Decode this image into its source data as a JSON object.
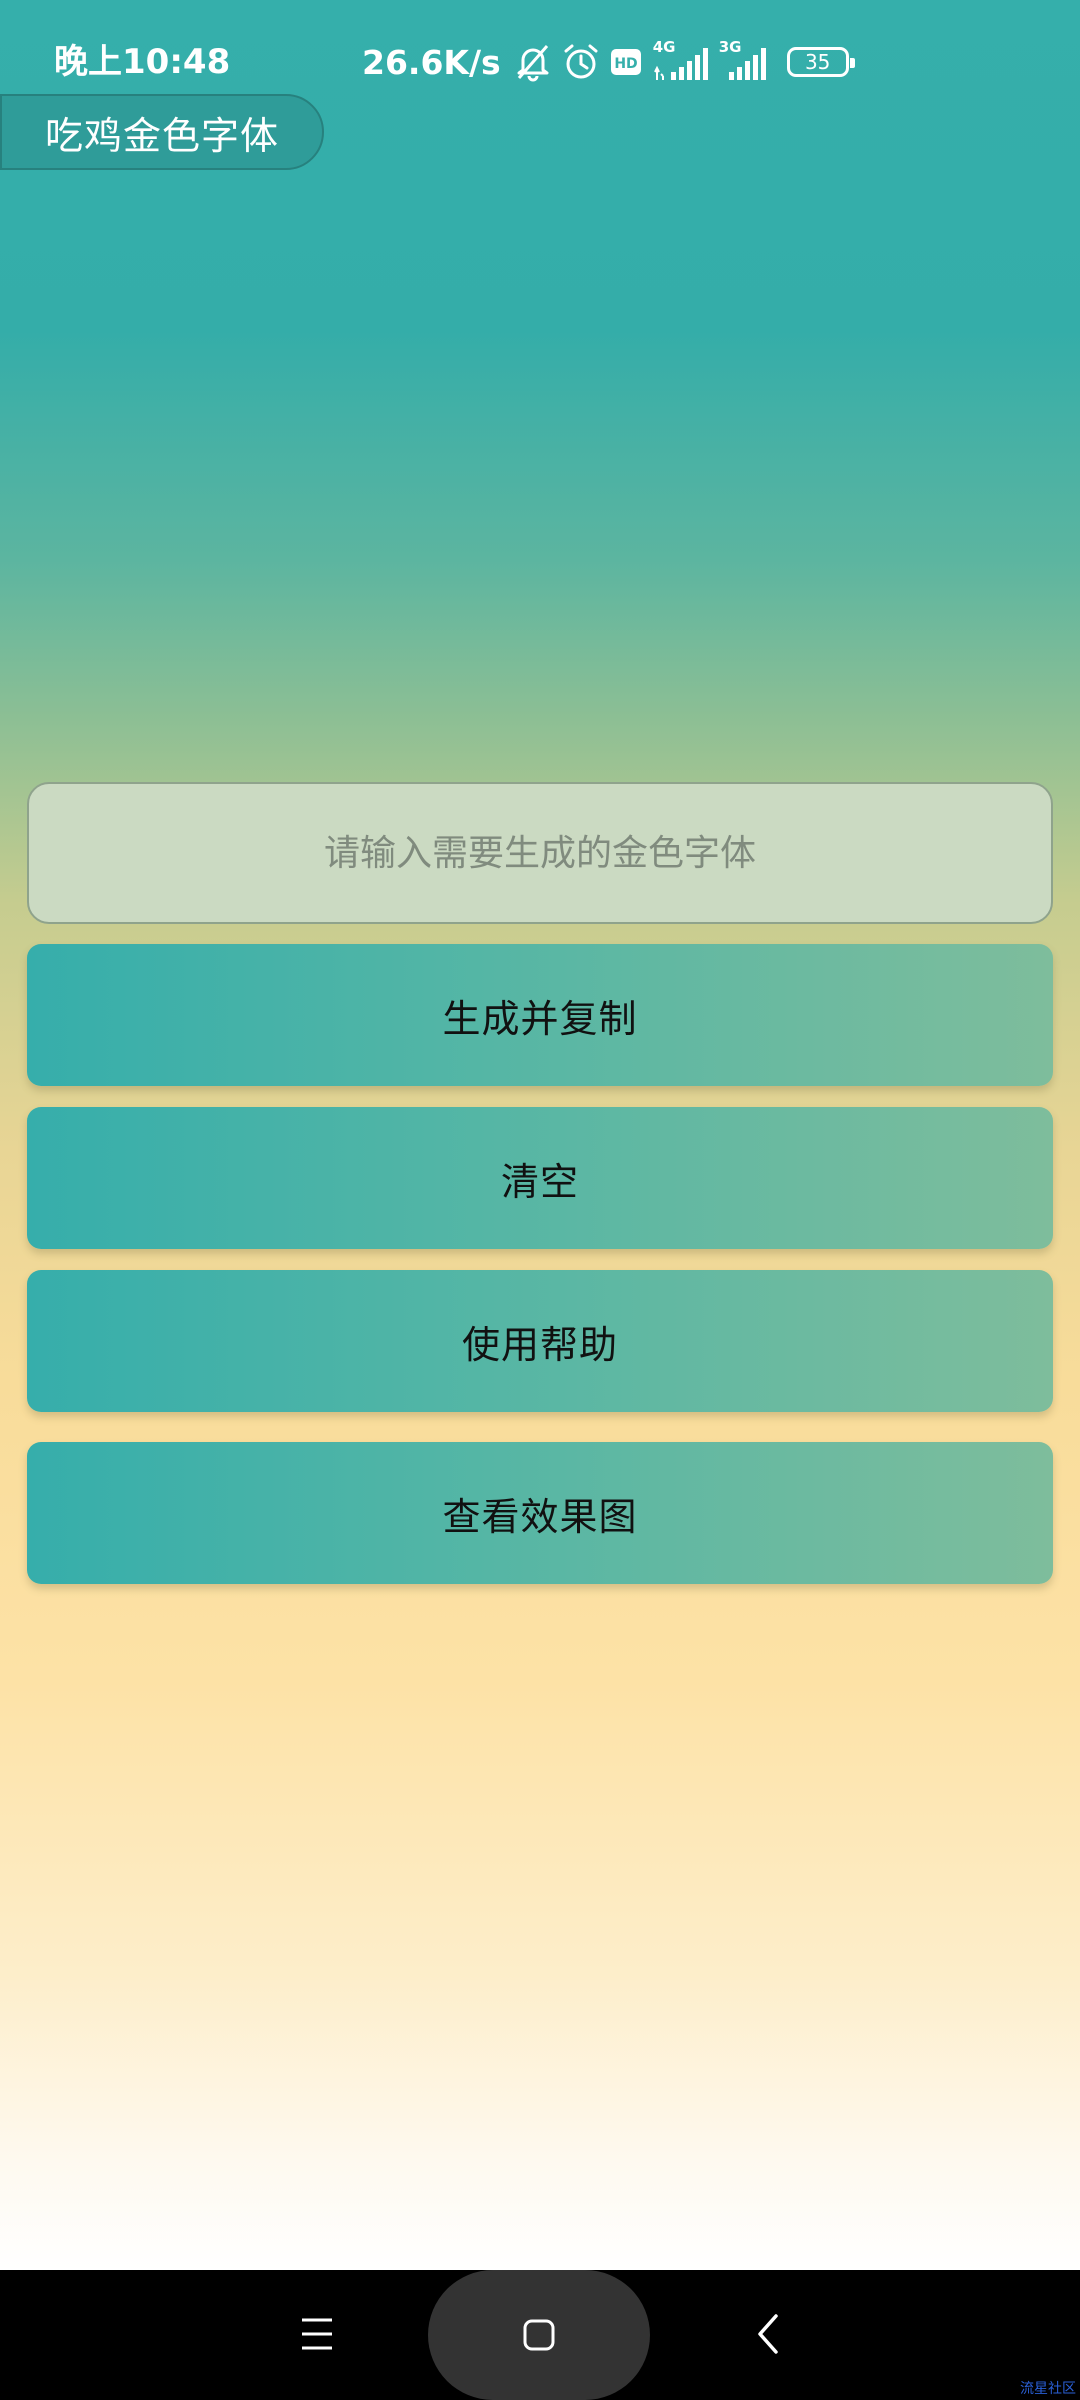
{
  "status_bar": {
    "time": "晚上10:48",
    "net_speed": "26.6K/s",
    "icons": [
      "mute-bell-icon",
      "alarm-icon",
      "hd-icon",
      "signal-4g-icon",
      "signal-3g-icon",
      "battery-icon"
    ],
    "net_4g": "4G",
    "net_3g": "3G",
    "hd_label": "HD",
    "battery": "35"
  },
  "app": {
    "title": "吃鸡金色字体"
  },
  "input": {
    "placeholder": "请输入需要生成的金色字体",
    "value": ""
  },
  "buttons": {
    "generate": "生成并复制",
    "clear": "清空",
    "help": "使用帮助",
    "preview": "查看效果图"
  },
  "nav_bar": {
    "icons": [
      "menu-icon",
      "home-icon",
      "back-icon"
    ]
  },
  "watermark": "流星社区",
  "colors": {
    "accent": "#35afab",
    "button_gradient_end": "#7ebd9c",
    "nav_background": "#000000"
  }
}
